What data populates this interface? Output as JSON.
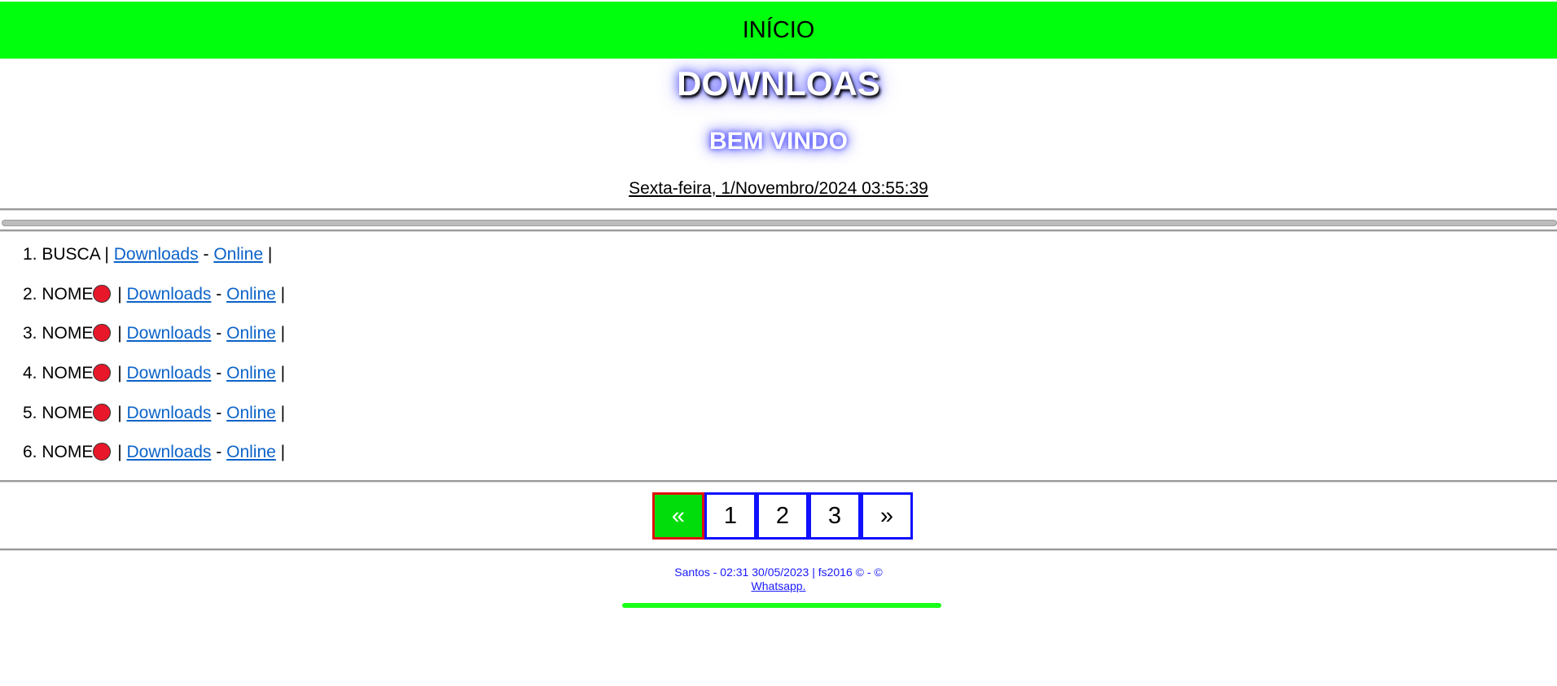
{
  "header": {
    "label": "INÍCIO",
    "color": "#00ff0d"
  },
  "title": "DOWNLOAS",
  "subtitle": "BEM VINDO",
  "datetime": "Sexta-feira, 1/Novembro/2024 03:55:39",
  "list": [
    {
      "num": "1.",
      "name": "BUSCA",
      "status_dot": false,
      "sep": "|",
      "link1": "Downloads",
      "dash": "-",
      "link2": "Online",
      "end": "|"
    },
    {
      "num": "2.",
      "name": "NOME",
      "status_dot": true,
      "sep": "|",
      "link1": "Downloads",
      "dash": "-",
      "link2": "Online",
      "end": "|"
    },
    {
      "num": "3.",
      "name": "NOME",
      "status_dot": true,
      "sep": "|",
      "link1": "Downloads",
      "dash": "-",
      "link2": "Online",
      "end": "|"
    },
    {
      "num": "4.",
      "name": "NOME",
      "status_dot": true,
      "sep": "|",
      "link1": "Downloads",
      "dash": "-",
      "link2": "Online",
      "end": "|"
    },
    {
      "num": "5.",
      "name": "NOME",
      "status_dot": true,
      "sep": "|",
      "link1": "Downloads",
      "dash": "-",
      "link2": "Online",
      "end": "|"
    },
    {
      "num": "6.",
      "name": "NOME",
      "status_dot": true,
      "sep": "|",
      "link1": "Downloads",
      "dash": "-",
      "link2": "Online",
      "end": "|"
    }
  ],
  "pagination": {
    "prev": "«",
    "pages": [
      "1",
      "2",
      "3"
    ],
    "next": "»"
  },
  "footer": {
    "credits": "Santos - 02:31 30/05/2023 | fs2016 © - ©",
    "whatsapp": "Whatsapp."
  },
  "status_dot_color": "#e8182a"
}
